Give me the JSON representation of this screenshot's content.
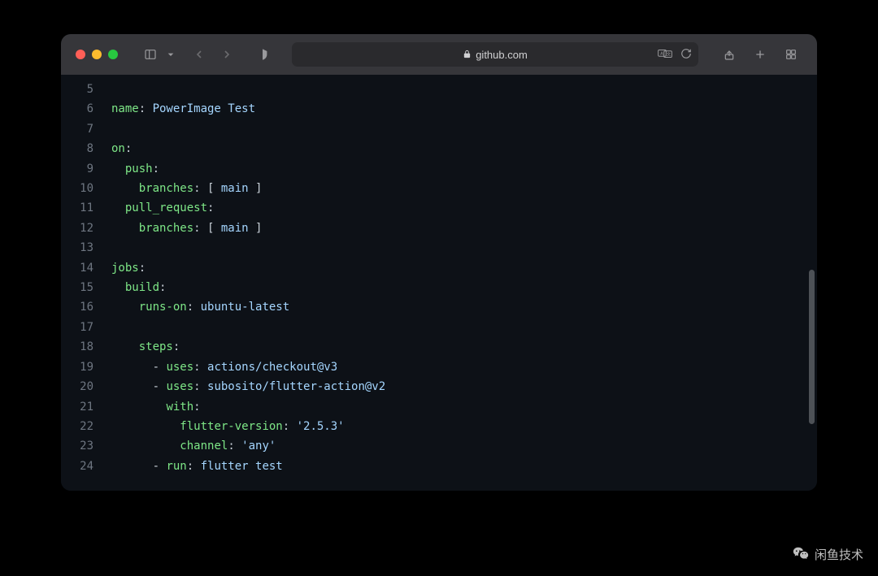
{
  "browser": {
    "domain": "github.com"
  },
  "code": {
    "lines": [
      {
        "num": "5",
        "tokens": []
      },
      {
        "num": "6",
        "tokens": [
          {
            "t": "key",
            "v": "name"
          },
          {
            "t": "punct",
            "v": ": "
          },
          {
            "t": "val",
            "v": "PowerImage Test"
          }
        ]
      },
      {
        "num": "7",
        "tokens": []
      },
      {
        "num": "8",
        "tokens": [
          {
            "t": "key",
            "v": "on"
          },
          {
            "t": "punct",
            "v": ":"
          }
        ]
      },
      {
        "num": "9",
        "tokens": [
          {
            "t": "indent",
            "v": "  "
          },
          {
            "t": "key",
            "v": "push"
          },
          {
            "t": "punct",
            "v": ":"
          }
        ]
      },
      {
        "num": "10",
        "tokens": [
          {
            "t": "indent",
            "v": "    "
          },
          {
            "t": "key",
            "v": "branches"
          },
          {
            "t": "punct",
            "v": ": [ "
          },
          {
            "t": "val",
            "v": "main"
          },
          {
            "t": "punct",
            "v": " ]"
          }
        ]
      },
      {
        "num": "11",
        "tokens": [
          {
            "t": "indent",
            "v": "  "
          },
          {
            "t": "key",
            "v": "pull_request"
          },
          {
            "t": "punct",
            "v": ":"
          }
        ]
      },
      {
        "num": "12",
        "tokens": [
          {
            "t": "indent",
            "v": "    "
          },
          {
            "t": "key",
            "v": "branches"
          },
          {
            "t": "punct",
            "v": ": [ "
          },
          {
            "t": "val",
            "v": "main"
          },
          {
            "t": "punct",
            "v": " ]"
          }
        ]
      },
      {
        "num": "13",
        "tokens": []
      },
      {
        "num": "14",
        "tokens": [
          {
            "t": "key",
            "v": "jobs"
          },
          {
            "t": "punct",
            "v": ":"
          }
        ]
      },
      {
        "num": "15",
        "tokens": [
          {
            "t": "indent",
            "v": "  "
          },
          {
            "t": "key",
            "v": "build"
          },
          {
            "t": "punct",
            "v": ":"
          }
        ]
      },
      {
        "num": "16",
        "tokens": [
          {
            "t": "indent",
            "v": "    "
          },
          {
            "t": "key",
            "v": "runs-on"
          },
          {
            "t": "punct",
            "v": ": "
          },
          {
            "t": "val",
            "v": "ubuntu-latest"
          }
        ]
      },
      {
        "num": "17",
        "tokens": []
      },
      {
        "num": "18",
        "tokens": [
          {
            "t": "indent",
            "v": "    "
          },
          {
            "t": "key",
            "v": "steps"
          },
          {
            "t": "punct",
            "v": ":"
          }
        ]
      },
      {
        "num": "19",
        "tokens": [
          {
            "t": "indent",
            "v": "      "
          },
          {
            "t": "dash",
            "v": "- "
          },
          {
            "t": "key",
            "v": "uses"
          },
          {
            "t": "punct",
            "v": ": "
          },
          {
            "t": "val",
            "v": "actions/checkout@v3"
          }
        ]
      },
      {
        "num": "20",
        "tokens": [
          {
            "t": "indent",
            "v": "      "
          },
          {
            "t": "dash",
            "v": "- "
          },
          {
            "t": "key",
            "v": "uses"
          },
          {
            "t": "punct",
            "v": ": "
          },
          {
            "t": "val",
            "v": "subosito/flutter-action@v2"
          }
        ]
      },
      {
        "num": "21",
        "tokens": [
          {
            "t": "indent",
            "v": "        "
          },
          {
            "t": "key",
            "v": "with"
          },
          {
            "t": "punct",
            "v": ":"
          }
        ]
      },
      {
        "num": "22",
        "tokens": [
          {
            "t": "indent",
            "v": "          "
          },
          {
            "t": "key",
            "v": "flutter-version"
          },
          {
            "t": "punct",
            "v": ": "
          },
          {
            "t": "val",
            "v": "'2.5.3'"
          }
        ]
      },
      {
        "num": "23",
        "tokens": [
          {
            "t": "indent",
            "v": "          "
          },
          {
            "t": "key",
            "v": "channel"
          },
          {
            "t": "punct",
            "v": ": "
          },
          {
            "t": "val",
            "v": "'any'"
          }
        ]
      },
      {
        "num": "24",
        "tokens": [
          {
            "t": "indent",
            "v": "      "
          },
          {
            "t": "dash",
            "v": "- "
          },
          {
            "t": "key",
            "v": "run"
          },
          {
            "t": "punct",
            "v": ": "
          },
          {
            "t": "val",
            "v": "flutter test"
          }
        ]
      }
    ]
  },
  "watermark": {
    "text": "闲鱼技术"
  }
}
